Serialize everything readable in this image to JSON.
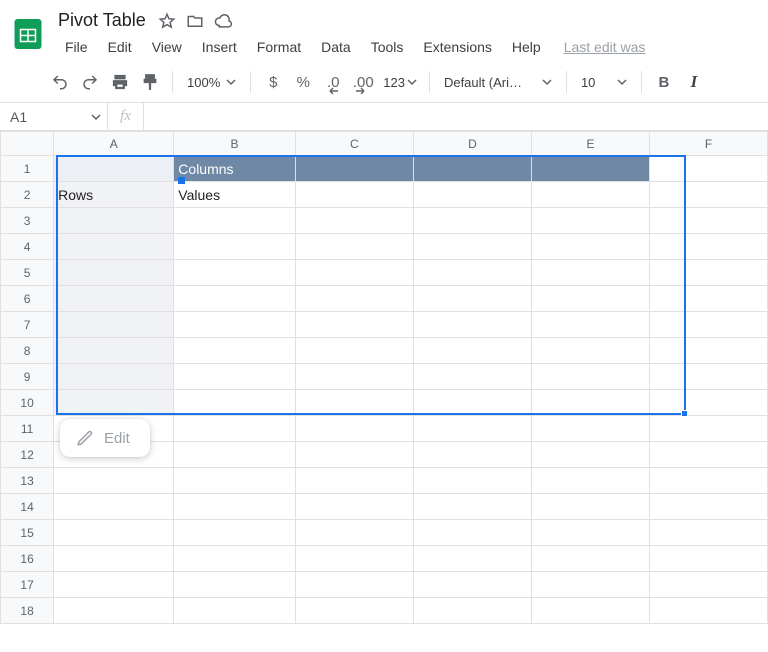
{
  "doc": {
    "title": "Pivot Table",
    "last_edit": "Last edit was"
  },
  "menu": {
    "file": "File",
    "edit": "Edit",
    "view": "View",
    "insert": "Insert",
    "format": "Format",
    "data": "Data",
    "tools": "Tools",
    "extensions": "Extensions",
    "help": "Help"
  },
  "toolbar": {
    "zoom": "100%",
    "currency": "$",
    "percent": "%",
    "dec_dec": ".0",
    "inc_dec": ".00",
    "more_fmt": "123",
    "font": "Default (Ari…",
    "font_size": "10",
    "bold": "B",
    "italic": "I"
  },
  "namebox": {
    "ref": "A1",
    "fx": "fx",
    "formula": ""
  },
  "columns": [
    "A",
    "B",
    "C",
    "D",
    "E",
    "F"
  ],
  "rows": [
    "1",
    "2",
    "3",
    "4",
    "5",
    "6",
    "7",
    "8",
    "9",
    "10",
    "11",
    "12",
    "13",
    "14",
    "15",
    "16",
    "17",
    "18"
  ],
  "pivot": {
    "columns_label": "Columns",
    "rows_label": "Rows",
    "values_label": "Values"
  },
  "popup": {
    "edit": "Edit"
  }
}
